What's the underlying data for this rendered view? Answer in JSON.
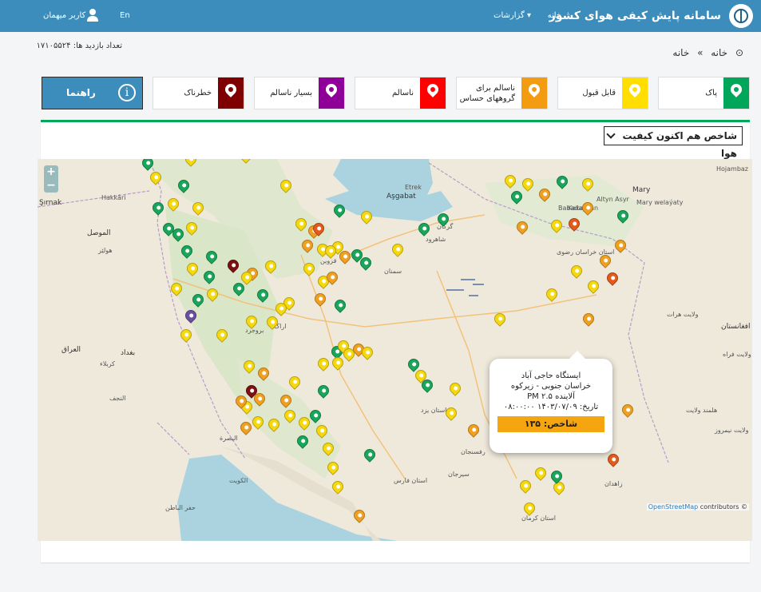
{
  "header": {
    "title": "سامانه پایش کیفی هوای کشور",
    "nav_home": "خانه",
    "nav_reports": "گزارشات",
    "user": "کاربر میهمان",
    "lang": "En"
  },
  "visits": {
    "label": "تعداد بازدید ها: ۱۷۱۰۵۵۲۴"
  },
  "breadcrumb": {
    "home": "خانه",
    "separator": "»",
    "current": "خانه"
  },
  "legend": [
    {
      "label": "پاک",
      "color": "#00a65a"
    },
    {
      "label": "قابل قبول",
      "color": "#ffde00"
    },
    {
      "label": "ناسالم برای گروههای حساس",
      "color": "#f39c12"
    },
    {
      "label": "ناسالم",
      "color": "#ff0000"
    },
    {
      "label": "بسیار ناسالم",
      "color": "#8e0097"
    },
    {
      "label": "خطرناک",
      "color": "#7e0000"
    }
  ],
  "guide_button": "راهنما",
  "index_selector": {
    "selected": "شاخص هم اکنون کیفیت هوا"
  },
  "map": {
    "zoom_in": "+",
    "zoom_out": "−",
    "labels": {
      "ashgabat": "Aşgabat",
      "babadayhan": "Babadayhan",
      "hojambaz": "Hojambaz",
      "etrek": "Etrek",
      "mary": "Mary",
      "mary_welayaty": "Mary welaýaty",
      "altyn_asyr": "Altyn Asyr",
      "kaka": "Kaka",
      "sirnak": "Şırnak",
      "hakkari": "Hakkâri",
      "mosul": "الموصل",
      "erbil": "هولێر",
      "baghdad": "بغداد",
      "iraq": "العراق",
      "karbala": "كربلاء",
      "najaf": "النجف",
      "basra": "البصرة",
      "kuwait": "الكويت",
      "hafr": "حفر الباطن",
      "afghanistan": "افغانستان",
      "herat": "ولایت هرات",
      "farah": "ولایت فراه",
      "helmand": "هلمند ولایت",
      "nimruz": "ولایت نیمروز",
      "zahedan": "زاهدان",
      "semnan": "سمنان",
      "shahrud": "شاهرود",
      "gorgan": "گرگان",
      "arak": "اراک",
      "yazd": "استان یزد",
      "kerman": "استان کرمان",
      "rafsanjan": "رفسنجان",
      "sirjan": "سیرجان",
      "qazvin": "قزوین",
      "boroujerd": "بروجرد",
      "fars": "استان فارس",
      "razavi": "استان خراسان رضوی"
    },
    "attribution": "© OpenStreetMap contributors",
    "attribution_link": "OpenStreetMap",
    "attribution_suffix": " contributors ©"
  },
  "popup": {
    "station": "ایستگاه حاجی آباد",
    "region": "خراسان جنوبی - زیرکوه",
    "pollutant": "آلاینده PM ۲.۵",
    "date": "تاریخ: ۱۴۰۳/۰۷/۰۹ ۰۸:۰۰:۰۰",
    "index": "شاخص: ۱۳۵",
    "index_color": "#f5a510"
  },
  "marker_colors": {
    "G": "#1aa55a",
    "Y": "#f5d80f",
    "O": "#f0a020",
    "R": "#e25a1c",
    "D": "#7e1010",
    "P": "#6a4fa0"
  },
  "markers": [
    [
      "G",
      185,
      215
    ],
    [
      "Y",
      239,
      210
    ],
    [
      "G",
      230,
      243
    ],
    [
      "Y",
      195,
      233
    ],
    [
      "G",
      198,
      271
    ],
    [
      "Y",
      217,
      266
    ],
    [
      "Y",
      248,
      271
    ],
    [
      "G",
      211,
      297
    ],
    [
      "G",
      223,
      304
    ],
    [
      "Y",
      240,
      296
    ],
    [
      "G",
      234,
      325
    ],
    [
      "G",
      265,
      332
    ],
    [
      "D",
      292,
      343
    ],
    [
      "O",
      316,
      353
    ],
    [
      "Y",
      241,
      347
    ],
    [
      "G",
      262,
      357
    ],
    [
      "G",
      299,
      372
    ],
    [
      "Y",
      309,
      358
    ],
    [
      "G",
      329,
      380
    ],
    [
      "Y",
      266,
      379
    ],
    [
      "Y",
      221,
      372
    ],
    [
      "G",
      248,
      386
    ],
    [
      "P",
      239,
      406
    ],
    [
      "Y",
      233,
      430
    ],
    [
      "Y",
      278,
      430
    ],
    [
      "Y",
      315,
      413
    ],
    [
      "Y",
      341,
      414
    ],
    [
      "Y",
      362,
      390
    ],
    [
      "Y",
      352,
      397
    ],
    [
      "Y",
      339,
      344
    ],
    [
      "Y",
      308,
      206
    ],
    [
      "Y",
      358,
      243
    ],
    [
      "G",
      425,
      274
    ],
    [
      "Y",
      377,
      291
    ],
    [
      "O",
      393,
      300
    ],
    [
      "R",
      399,
      297
    ],
    [
      "Y",
      404,
      323
    ],
    [
      "O",
      385,
      318
    ],
    [
      "Y",
      423,
      320
    ],
    [
      "G",
      447,
      330
    ],
    [
      "G",
      458,
      340
    ],
    [
      "O",
      432,
      332
    ],
    [
      "Y",
      387,
      347
    ],
    [
      "Y",
      405,
      363
    ],
    [
      "O",
      416,
      358
    ],
    [
      "O",
      401,
      385
    ],
    [
      "G",
      426,
      393
    ],
    [
      "Y",
      414,
      325
    ],
    [
      "Y",
      459,
      282
    ],
    [
      "G",
      531,
      297
    ],
    [
      "G",
      555,
      285
    ],
    [
      "Y",
      498,
      323
    ],
    [
      "O",
      449,
      448
    ],
    [
      "G",
      422,
      451
    ],
    [
      "Y",
      430,
      444
    ],
    [
      "Y",
      405,
      466
    ],
    [
      "Y",
      437,
      454
    ],
    [
      "Y",
      460,
      452
    ],
    [
      "Y",
      423,
      465
    ],
    [
      "G",
      518,
      467
    ],
    [
      "Y",
      527,
      481
    ],
    [
      "G",
      535,
      493
    ],
    [
      "Y",
      570,
      497
    ],
    [
      "Y",
      565,
      528
    ],
    [
      "O",
      593,
      549
    ],
    [
      "G",
      405,
      500
    ],
    [
      "Y",
      369,
      489
    ],
    [
      "D",
      315,
      500
    ],
    [
      "O",
      325,
      510
    ],
    [
      "O",
      330,
      478
    ],
    [
      "Y",
      312,
      469
    ],
    [
      "Y",
      309,
      520
    ],
    [
      "O",
      302,
      513
    ],
    [
      "O",
      358,
      512
    ],
    [
      "Y",
      363,
      531
    ],
    [
      "Y",
      381,
      540
    ],
    [
      "Y",
      403,
      550
    ],
    [
      "G",
      395,
      531
    ],
    [
      "O",
      308,
      546
    ],
    [
      "Y",
      323,
      539
    ],
    [
      "Y",
      343,
      542
    ],
    [
      "G",
      379,
      563
    ],
    [
      "G",
      463,
      580
    ],
    [
      "Y",
      411,
      572
    ],
    [
      "Y",
      417,
      596
    ],
    [
      "Y",
      423,
      620
    ],
    [
      "O",
      450,
      656
    ],
    [
      "Y",
      658,
      619
    ],
    [
      "Y",
      677,
      603
    ],
    [
      "Y",
      700,
      621
    ],
    [
      "G",
      697,
      607
    ],
    [
      "Y",
      663,
      647
    ],
    [
      "Y",
      639,
      237
    ],
    [
      "Y",
      661,
      241
    ],
    [
      "G",
      647,
      257
    ],
    [
      "G",
      704,
      238
    ],
    [
      "O",
      682,
      254
    ],
    [
      "Y",
      736,
      241
    ],
    [
      "O",
      736,
      271
    ],
    [
      "Y",
      697,
      293
    ],
    [
      "R",
      719,
      291
    ],
    [
      "O",
      654,
      295
    ],
    [
      "G",
      780,
      281
    ],
    [
      "O",
      777,
      318
    ],
    [
      "O",
      758,
      337
    ],
    [
      "R",
      767,
      359
    ],
    [
      "Y",
      743,
      369
    ],
    [
      "Y",
      722,
      350
    ],
    [
      "Y",
      691,
      379
    ],
    [
      "Y",
      626,
      410
    ],
    [
      "O",
      737,
      410
    ],
    [
      "O",
      786,
      524
    ],
    [
      "R",
      768,
      586
    ]
  ]
}
